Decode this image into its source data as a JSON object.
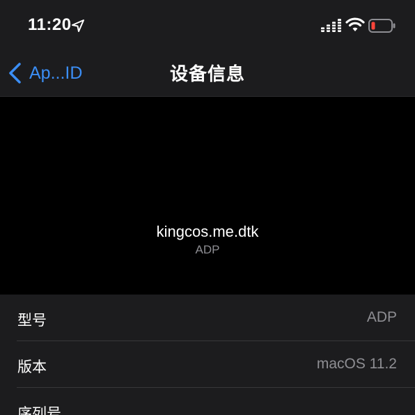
{
  "status_bar": {
    "time": "11:20",
    "icons": [
      "location-arrow-icon",
      "cellular-signal-icon",
      "wifi-icon",
      "battery-low-icon"
    ],
    "battery_color": "#ff453a"
  },
  "nav": {
    "back_label": "Ap...ID",
    "title": "设备信息",
    "accent_color": "#3b8ef5"
  },
  "device": {
    "name": "kingcos.me.dtk",
    "model": "ADP"
  },
  "info_rows": [
    {
      "label": "型号",
      "value": "ADP"
    },
    {
      "label": "版本",
      "value": "macOS 11.2"
    },
    {
      "label": "序列号",
      "value": ""
    }
  ]
}
